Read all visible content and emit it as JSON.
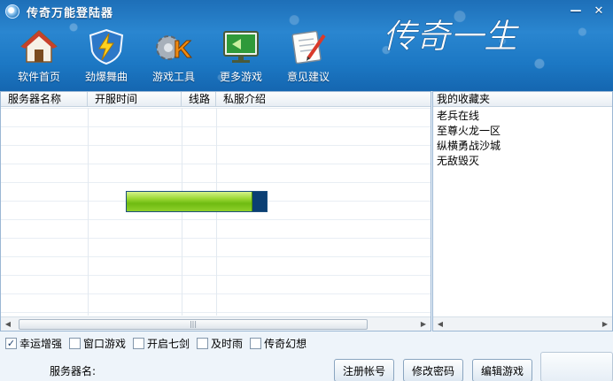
{
  "window": {
    "title": "传奇万能登陆器",
    "logo_text": "传奇一生",
    "controls": [
      "—",
      "✕"
    ]
  },
  "toolbar": {
    "items": [
      {
        "label": "软件首页",
        "icon": "home-icon"
      },
      {
        "label": "劲爆舞曲",
        "icon": "lightning-shield-icon"
      },
      {
        "label": "游戏工具",
        "icon": "gear-k-icon"
      },
      {
        "label": "更多游戏",
        "icon": "monitor-icon"
      },
      {
        "label": "意见建议",
        "icon": "notepad-pen-icon"
      }
    ]
  },
  "server_list": {
    "columns": [
      "服务器名称",
      "开服时间",
      "线路",
      "私服介绍"
    ],
    "progress": 0.9
  },
  "favorites": {
    "title": "我的收藏夹",
    "items": [
      "老兵在线",
      "至尊火龙一区",
      "纵横勇战沙城",
      "无敌毁灭"
    ]
  },
  "options": [
    {
      "label": "幸运增强",
      "checked": true
    },
    {
      "label": "窗口游戏",
      "checked": false
    },
    {
      "label": "开启七剑",
      "checked": false
    },
    {
      "label": "及时雨",
      "checked": false
    },
    {
      "label": "传奇幻想",
      "checked": false
    }
  ],
  "bottom": {
    "server_label": "服务器名:",
    "register_label": "注册帐号",
    "change_password_label": "修改密码",
    "edit_game_label": "编辑游戏"
  },
  "scrollbar": {
    "left_arrow": "◀",
    "right_arrow": "▶",
    "thumb_grip": "|||"
  }
}
